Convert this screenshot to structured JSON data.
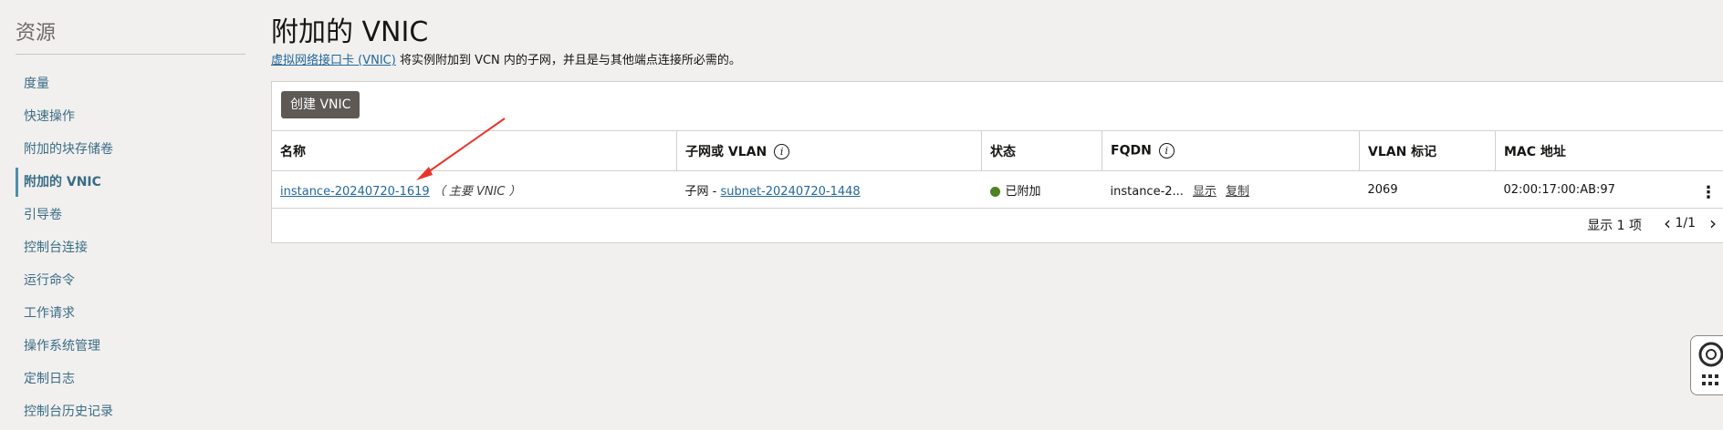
{
  "sidebar": {
    "title": "资源",
    "items": [
      {
        "label": "度量"
      },
      {
        "label": "快速操作"
      },
      {
        "label": "附加的块存储卷"
      },
      {
        "label": "附加的 VNIC"
      },
      {
        "label": "引导卷"
      },
      {
        "label": "控制台连接"
      },
      {
        "label": "运行命令"
      },
      {
        "label": "工作请求"
      },
      {
        "label": "操作系统管理"
      },
      {
        "label": "定制日志"
      },
      {
        "label": "控制台历史记录"
      }
    ]
  },
  "header": {
    "title": "附加的 VNIC",
    "desc_link": "虚拟网络接口卡 (VNIC)",
    "desc_text": " 将实例附加到 VCN 内的子网，并且是与其他端点连接所必需的。"
  },
  "toolbar": {
    "create_label": "创建 VNIC"
  },
  "table": {
    "columns": [
      "名称",
      "子网或 VLAN",
      "状态",
      "FQDN",
      "VLAN 标记",
      "MAC 地址"
    ],
    "rows": [
      {
        "name": "instance-20240720-1619",
        "name_note": "（ 主要 VNIC ）",
        "subnet_prefix": "子网 - ",
        "subnet": "subnet-20240720-1448",
        "status": "已附加",
        "fqdn": "instance-2...",
        "fqdn_show": "显示",
        "fqdn_copy": "复制",
        "vlan_tag": "2069",
        "mac": "02:00:17:00:AB:97"
      }
    ]
  },
  "footer": {
    "count_text": "显示 1 项",
    "page": "1/1"
  },
  "colors": {
    "link": "#22689c",
    "status_ok": "#508223",
    "button_bg": "#5e5955",
    "annotation": "#e8352b"
  }
}
